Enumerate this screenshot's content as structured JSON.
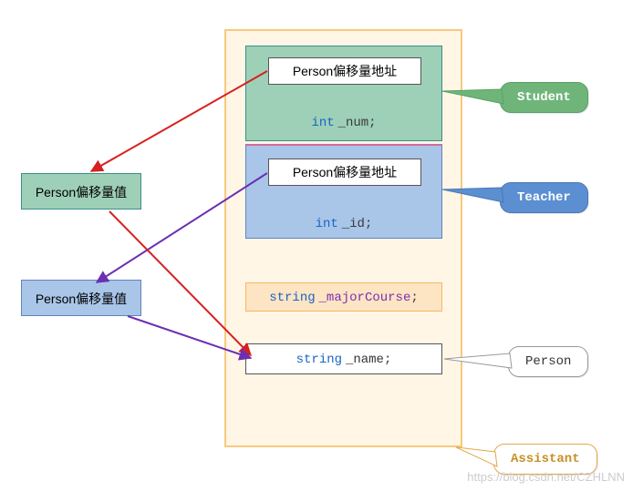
{
  "left": {
    "offset_value_1": "Person偏移量值",
    "offset_value_2": "Person偏移量值"
  },
  "container": {
    "student": {
      "offset_addr": "Person偏移量地址",
      "member_type": "int",
      "member_name": "_num",
      "semicolon": ";"
    },
    "teacher": {
      "offset_addr": "Person偏移量地址",
      "member_type": "int",
      "member_name": "_id",
      "semicolon": ";"
    },
    "major": {
      "type": "string",
      "name": "_majorCourse",
      "semicolon": ";"
    },
    "nameField": {
      "type": "string",
      "name": "_name",
      "semicolon": ";"
    }
  },
  "callouts": {
    "student": "Student",
    "teacher": "Teacher",
    "person": "Person",
    "assistant": "Assistant"
  },
  "colors": {
    "green_fill": "#8fc7ab",
    "blue_fill": "#a9c5e8",
    "student_callout": "#6fb57a",
    "teacher_callout": "#5b8fd1",
    "assistant_text": "#c69024"
  },
  "watermark": "https://blog.csdn.net/CZHLNN"
}
